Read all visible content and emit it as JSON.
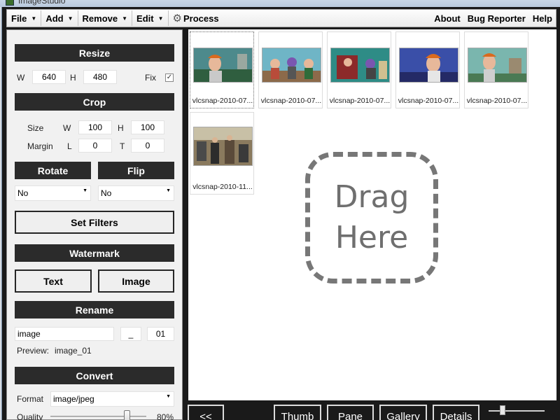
{
  "window": {
    "title": "ImageStudio"
  },
  "menubar": {
    "left": [
      {
        "label": "File"
      },
      {
        "label": "Add"
      },
      {
        "label": "Remove"
      },
      {
        "label": "Edit"
      }
    ],
    "process_label": "Process",
    "right": [
      {
        "label": "About"
      },
      {
        "label": "Bug Reporter"
      },
      {
        "label": "Help"
      }
    ]
  },
  "resize": {
    "header": "Resize",
    "w_label": "W",
    "w_value": "640",
    "h_label": "H",
    "h_value": "480",
    "fix_label": "Fix",
    "fix_checked": true,
    "check_glyph": "✓"
  },
  "crop": {
    "header": "Crop",
    "size_label": "Size",
    "w_label": "W",
    "w_value": "100",
    "h_label": "H",
    "h_value": "100",
    "margin_label": "Margin",
    "l_label": "L",
    "l_value": "0",
    "t_label": "T",
    "t_value": "0"
  },
  "rotate": {
    "header": "Rotate",
    "value": "No"
  },
  "flip": {
    "header": "Flip",
    "value": "No"
  },
  "filters": {
    "button": "Set Filters"
  },
  "watermark": {
    "header": "Watermark",
    "text_button": "Text",
    "image_button": "Image"
  },
  "rename": {
    "header": "Rename",
    "name_value": "image",
    "separator_value": "_",
    "number_value": "01",
    "preview_label": "Preview:",
    "preview_value": "image_01"
  },
  "convert": {
    "header": "Convert",
    "format_label": "Format",
    "format_value": "image/jpeg",
    "quality_label": "Quality",
    "quality_value": "80%",
    "quality_level": 0.8
  },
  "thumbnails": [
    {
      "caption": "vlcsnap-2010-07..."
    },
    {
      "caption": "vlcsnap-2010-07..."
    },
    {
      "caption": "vlcsnap-2010-07..."
    },
    {
      "caption": "vlcsnap-2010-07..."
    },
    {
      "caption": "vlcsnap-2010-07..."
    },
    {
      "caption": "vlcsnap-2010-11..."
    }
  ],
  "dropzone": {
    "line1": "Drag",
    "line2": "Here"
  },
  "bottombar": {
    "back": "<<",
    "thumb": "Thumb",
    "pane": "Pane",
    "gallery": "Gallery",
    "details": "Details"
  }
}
